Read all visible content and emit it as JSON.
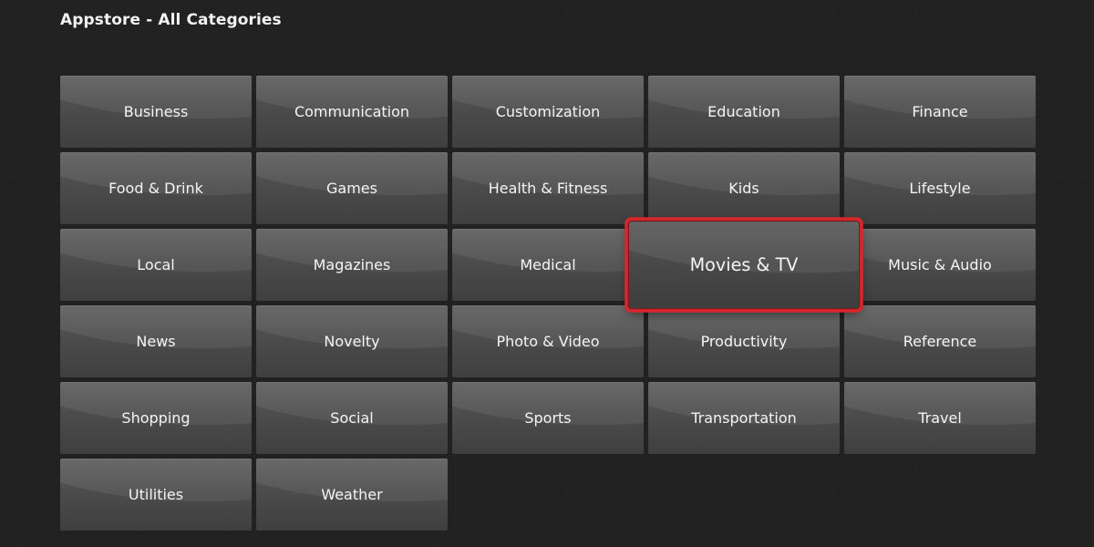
{
  "header": {
    "title": "Appstore - All Categories"
  },
  "categories": [
    {
      "label": "Business",
      "focused": false
    },
    {
      "label": "Communication",
      "focused": false
    },
    {
      "label": "Customization",
      "focused": false
    },
    {
      "label": "Education",
      "focused": false
    },
    {
      "label": "Finance",
      "focused": false
    },
    {
      "label": "Food & Drink",
      "focused": false
    },
    {
      "label": "Games",
      "focused": false
    },
    {
      "label": "Health & Fitness",
      "focused": false
    },
    {
      "label": "Kids",
      "focused": false
    },
    {
      "label": "Lifestyle",
      "focused": false
    },
    {
      "label": "Local",
      "focused": false
    },
    {
      "label": "Magazines",
      "focused": false
    },
    {
      "label": "Medical",
      "focused": false
    },
    {
      "label": "Movies & TV",
      "focused": true
    },
    {
      "label": "Music & Audio",
      "focused": false
    },
    {
      "label": "News",
      "focused": false
    },
    {
      "label": "Novelty",
      "focused": false
    },
    {
      "label": "Photo & Video",
      "focused": false
    },
    {
      "label": "Productivity",
      "focused": false
    },
    {
      "label": "Reference",
      "focused": false
    },
    {
      "label": "Shopping",
      "focused": false
    },
    {
      "label": "Social",
      "focused": false
    },
    {
      "label": "Sports",
      "focused": false
    },
    {
      "label": "Transportation",
      "focused": false
    },
    {
      "label": "Travel",
      "focused": false
    },
    {
      "label": "Utilities",
      "focused": false
    },
    {
      "label": "Weather",
      "focused": false
    }
  ],
  "colors": {
    "background": "#202020",
    "focus_outline": "#d8262b",
    "text": "#f4f4f4"
  }
}
